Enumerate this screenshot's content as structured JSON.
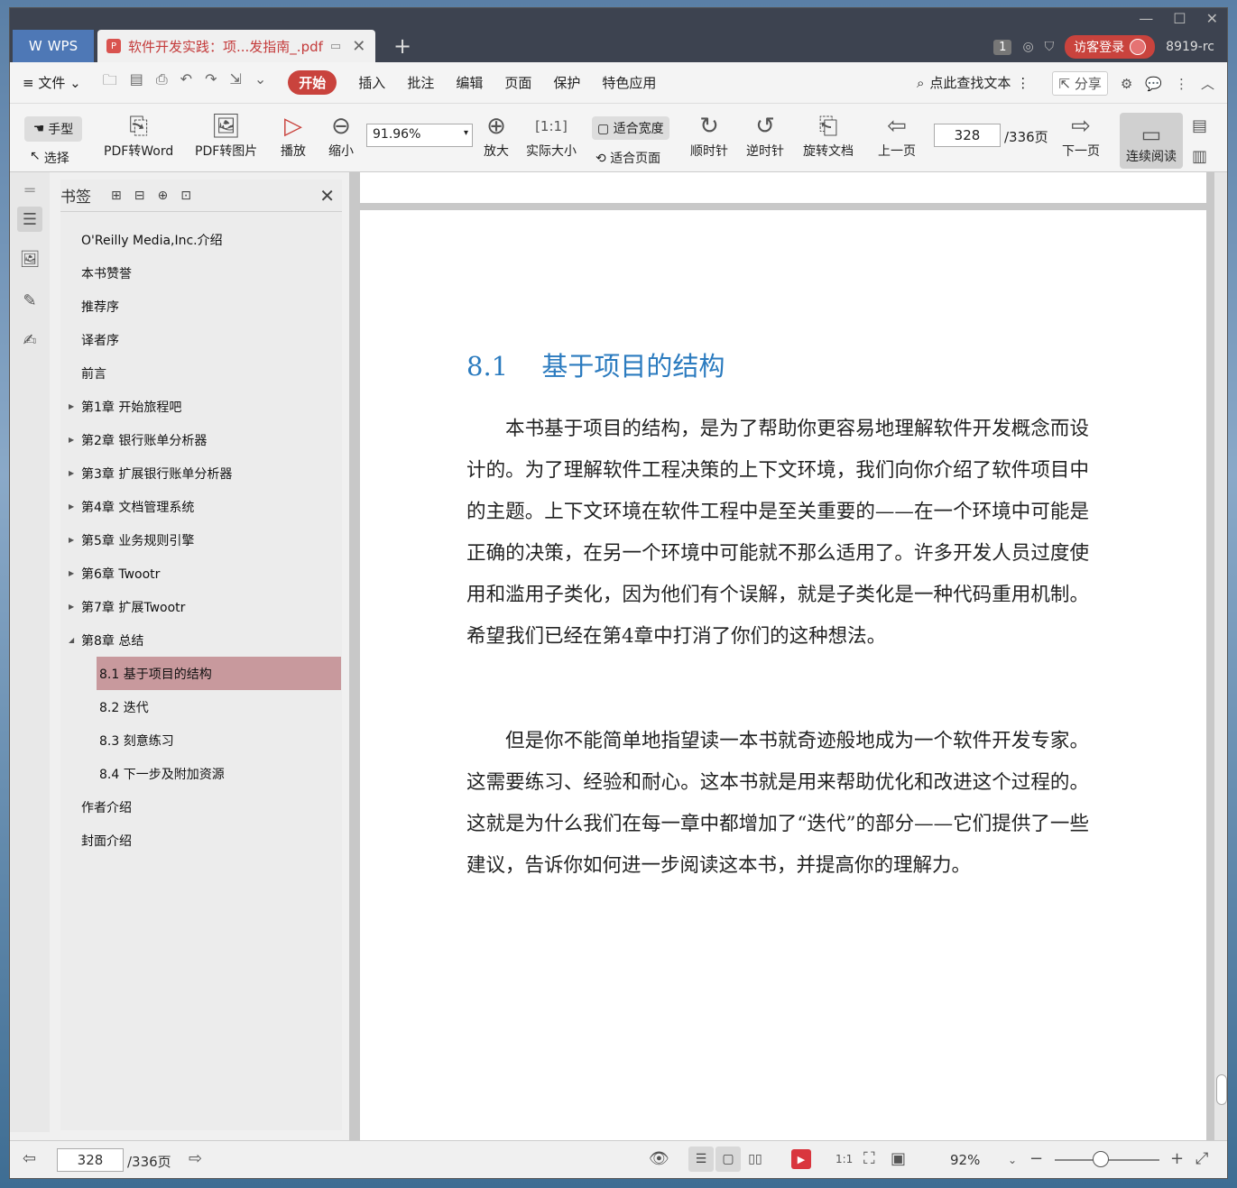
{
  "titlebar": {
    "app_tab": "WPS",
    "doc_tab": "软件开发实践：项...发指南_.pdf",
    "new_tab": "+",
    "badge_count": "1",
    "login_label": "访客登录",
    "user_id": "8919-rc"
  },
  "menubar": {
    "file": "文件",
    "tabs": [
      "开始",
      "插入",
      "批注",
      "编辑",
      "页面",
      "保护",
      "特色应用"
    ],
    "search_label": "点此查找文本",
    "share_label": "分享"
  },
  "toolbar": {
    "hand": "手型",
    "select": "选择",
    "pdf_to_word": "PDF转Word",
    "pdf_to_image": "PDF转图片",
    "play": "播放",
    "zoom_out": "缩小",
    "zoom_value": "91.96%",
    "zoom_in": "放大",
    "actual_size": "实际大小",
    "fit_width": "适合宽度",
    "fit_page": "适合页面",
    "rotate_cw": "顺时针",
    "rotate_ccw": "逆时针",
    "rotate_doc": "旋转文档",
    "prev_page": "上一页",
    "page_current": "328",
    "page_total": "/336页",
    "next_page": "下一页",
    "continuous": "连续阅读"
  },
  "bookmarks": {
    "title": "书签",
    "items": [
      {
        "label": "O'Reilly Media,Inc.介绍"
      },
      {
        "label": "本书赞誉"
      },
      {
        "label": "推荐序"
      },
      {
        "label": "译者序"
      },
      {
        "label": "前言"
      },
      {
        "label": "第1章 开始旅程吧"
      },
      {
        "label": "第2章 银行账单分析器"
      },
      {
        "label": "第3章 扩展银行账单分析器"
      },
      {
        "label": "第4章 文档管理系统"
      },
      {
        "label": "第5章 业务规则引擎"
      },
      {
        "label": "第6章 Twootr"
      },
      {
        "label": "第7章 扩展Twootr"
      },
      {
        "label": "第8章 总结"
      },
      {
        "label": "8.1 基于项目的结构"
      },
      {
        "label": "8.2 迭代"
      },
      {
        "label": "8.3 刻意练习"
      },
      {
        "label": "8.4 下一步及附加资源"
      },
      {
        "label": "作者介绍"
      },
      {
        "label": "封面介绍"
      }
    ]
  },
  "document": {
    "section_number": "8.1",
    "section_title": "基于项目的结构",
    "paragraph1": "本书基于项目的结构，是为了帮助你更容易地理解软件开发概念而设计的。为了理解软件工程决策的上下文环境，我们向你介绍了软件项目中的主题。上下文环境在软件工程中是至关重要的——在一个环境中可能是正确的决策，在另一个环境中可能就不那么适用了。许多开发人员过度使用和滥用子类化，因为他们有个误解，就是子类化是一种代码重用机制。希望我们已经在第4章中打消了你们的这种想法。",
    "paragraph2": "但是你不能简单地指望读一本书就奇迹般地成为一个软件开发专家。这需要练习、经验和耐心。这本书就是用来帮助优化和改进这个过程的。这就是为什么我们在每一章中都增加了“迭代”的部分——它们提供了一些建议，告诉你如何进一步阅读这本书，并提高你的理解力。"
  },
  "statusbar": {
    "page_current": "328",
    "page_total": "/336页",
    "zoom": "92%"
  },
  "colors": {
    "accent": "#c9433d",
    "heading": "#2b7bbf",
    "selected_bookmark": "#c8999d"
  }
}
